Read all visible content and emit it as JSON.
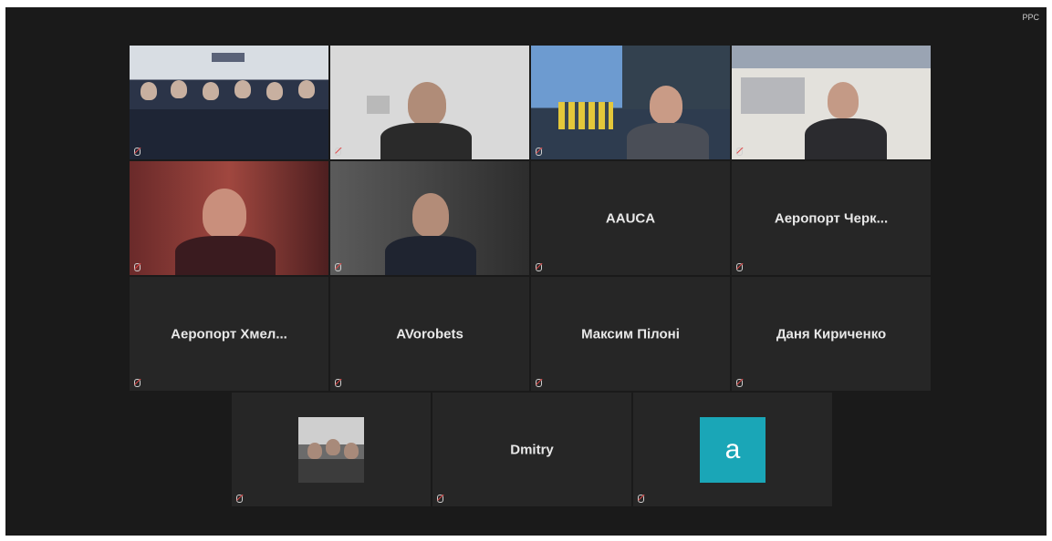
{
  "window": {
    "corner_label": "PPC"
  },
  "tiles": [
    {
      "label": "",
      "active": true
    },
    {
      "label": ""
    },
    {
      "label": ""
    },
    {
      "label": ""
    },
    {
      "label": ""
    },
    {
      "label": ""
    },
    {
      "name": "AAUCA",
      "label": ""
    },
    {
      "name": "Аеропорт Черк...",
      "label": ""
    },
    {
      "name": "Аеропорт Хмел...",
      "label": ""
    },
    {
      "name": "AVorobets",
      "label": ""
    },
    {
      "name": "Максим Пілоні",
      "label": ""
    },
    {
      "name": "Даня Кириченко",
      "label": ""
    },
    {
      "label": ""
    },
    {
      "name": "Dmitry",
      "label": ""
    },
    {
      "avatar_letter": "a",
      "label": ""
    }
  ],
  "colors": {
    "background": "#1a1a1a",
    "tile": "#262626",
    "active_border": "#d7d77a",
    "avatar": "#1aa6b7"
  }
}
